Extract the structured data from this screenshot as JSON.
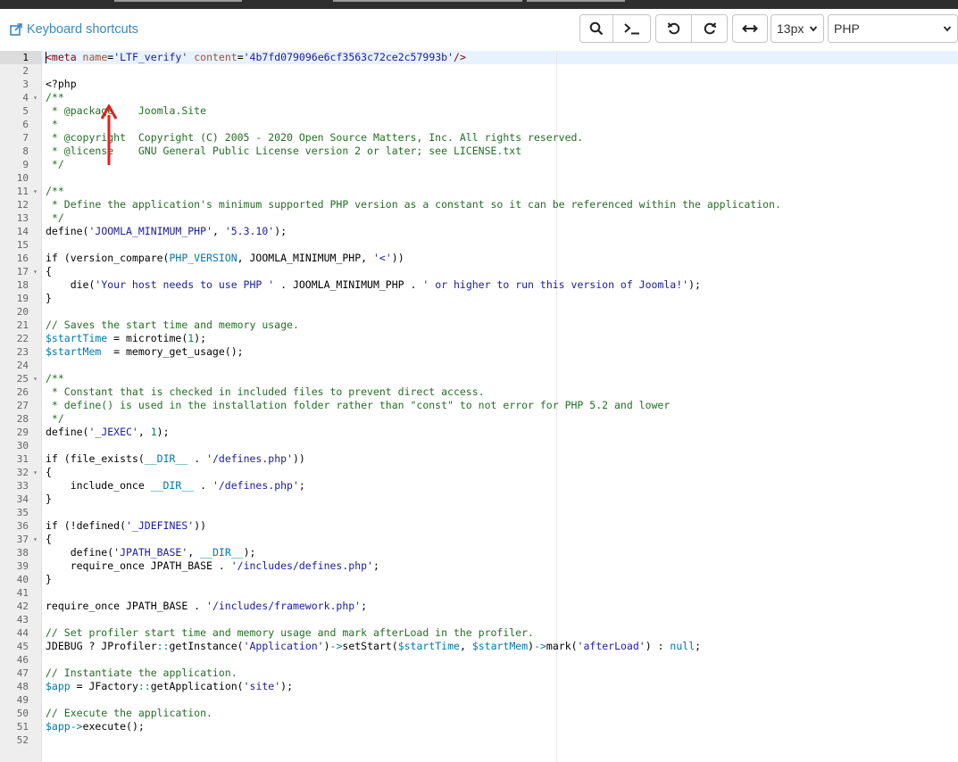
{
  "toolbar": {
    "shortcuts_label": "Keyboard shortcuts",
    "font_size": "13px",
    "language": "PHP",
    "icons": [
      "search-icon",
      "terminal-icon",
      "undo-icon",
      "redo-icon",
      "wrap-icon"
    ]
  },
  "colors": {
    "tag": "#800000",
    "attribute": "#a0522d",
    "string": "#1a1aa6",
    "comment": "#236e24",
    "variable": "#0077aa",
    "arrow": "#e02020"
  },
  "editor": {
    "active_line": 1,
    "fold_lines": [
      4,
      11,
      17,
      25,
      32,
      37
    ],
    "lines": [
      [
        [
          "tag",
          "<meta "
        ],
        [
          "attr",
          "name"
        ],
        [
          "def",
          "="
        ],
        [
          "str",
          "'LTF_verify'"
        ],
        [
          "def",
          " "
        ],
        [
          "attr",
          "content"
        ],
        [
          "def",
          "="
        ],
        [
          "str",
          "'4b7fd079096e6cf3563c72ce2c57993b'"
        ],
        [
          "tag",
          "/>"
        ]
      ],
      [],
      [
        [
          "def",
          "<?php"
        ]
      ],
      [
        [
          "com",
          "/**"
        ]
      ],
      [
        [
          "com",
          " * @package    Joomla.Site"
        ]
      ],
      [
        [
          "com",
          " *"
        ]
      ],
      [
        [
          "com",
          " * @copyright  Copyright (C) 2005 - 2020 Open Source Matters, Inc. All rights reserved."
        ]
      ],
      [
        [
          "com",
          " * @license    GNU General Public License version 2 or later; see LICENSE.txt"
        ]
      ],
      [
        [
          "com",
          " */"
        ]
      ],
      [],
      [
        [
          "com",
          "/**"
        ]
      ],
      [
        [
          "com",
          " * Define the application's minimum supported PHP version as a constant so it can be referenced within the application."
        ]
      ],
      [
        [
          "com",
          " */"
        ]
      ],
      [
        [
          "def",
          "define("
        ],
        [
          "str",
          "'JOOMLA_MINIMUM_PHP'"
        ],
        [
          "def",
          ", "
        ],
        [
          "str",
          "'5.3.10'"
        ],
        [
          "def",
          ");"
        ]
      ],
      [],
      [
        [
          "kw",
          "if"
        ],
        [
          "def",
          " (version_compare("
        ],
        [
          "var",
          "PHP_VERSION"
        ],
        [
          "def",
          ", JOOMLA_MINIMUM_PHP, "
        ],
        [
          "str",
          "'<'"
        ],
        [
          "def",
          "))"
        ]
      ],
      [
        [
          "def",
          "{"
        ]
      ],
      [
        [
          "def",
          "    die("
        ],
        [
          "str",
          "'Your host needs to use PHP '"
        ],
        [
          "def",
          " . JOOMLA_MINIMUM_PHP . "
        ],
        [
          "str",
          "' or higher to run this version of Joomla!'"
        ],
        [
          "def",
          ");"
        ]
      ],
      [
        [
          "def",
          "}"
        ]
      ],
      [],
      [
        [
          "com",
          "// Saves the start time and memory usage."
        ]
      ],
      [
        [
          "var",
          "$startTime"
        ],
        [
          "def",
          " = microtime("
        ],
        [
          "num",
          "1"
        ],
        [
          "def",
          ");"
        ]
      ],
      [
        [
          "var",
          "$startMem"
        ],
        [
          "def",
          "  = memory_get_usage();"
        ]
      ],
      [],
      [
        [
          "com",
          "/**"
        ]
      ],
      [
        [
          "com",
          " * Constant that is checked in included files to prevent direct access."
        ]
      ],
      [
        [
          "com",
          " * define() is used in the installation folder rather than \"const\" to not error for PHP 5.2 and lower"
        ]
      ],
      [
        [
          "com",
          " */"
        ]
      ],
      [
        [
          "def",
          "define("
        ],
        [
          "str",
          "'_JEXEC'"
        ],
        [
          "def",
          ", "
        ],
        [
          "num",
          "1"
        ],
        [
          "def",
          ");"
        ]
      ],
      [],
      [
        [
          "kw",
          "if"
        ],
        [
          "def",
          " (file_exists("
        ],
        [
          "var",
          "__DIR__"
        ],
        [
          "def",
          " . "
        ],
        [
          "str",
          "'/defines.php'"
        ],
        [
          "def",
          "))"
        ]
      ],
      [
        [
          "def",
          "{"
        ]
      ],
      [
        [
          "def",
          "    include_once "
        ],
        [
          "var",
          "__DIR__"
        ],
        [
          "def",
          " . "
        ],
        [
          "str",
          "'/defines.php'"
        ],
        [
          "def",
          ";"
        ]
      ],
      [
        [
          "def",
          "}"
        ]
      ],
      [],
      [
        [
          "kw",
          "if"
        ],
        [
          "def",
          " (!defined("
        ],
        [
          "str",
          "'_JDEFINES'"
        ],
        [
          "def",
          "))"
        ]
      ],
      [
        [
          "def",
          "{"
        ]
      ],
      [
        [
          "def",
          "    define("
        ],
        [
          "str",
          "'JPATH_BASE'"
        ],
        [
          "def",
          ", "
        ],
        [
          "var",
          "__DIR__"
        ],
        [
          "def",
          ");"
        ]
      ],
      [
        [
          "def",
          "    require_once JPATH_BASE . "
        ],
        [
          "str",
          "'/includes/defines.php'"
        ],
        [
          "def",
          ";"
        ]
      ],
      [
        [
          "def",
          "}"
        ]
      ],
      [],
      [
        [
          "def",
          "require_once JPATH_BASE . "
        ],
        [
          "str",
          "'/includes/framework.php'"
        ],
        [
          "def",
          ";"
        ]
      ],
      [],
      [
        [
          "com",
          "// Set profiler start time and memory usage and mark afterLoad in the profiler."
        ]
      ],
      [
        [
          "def",
          "JDEBUG ? JProfiler"
        ],
        [
          "var",
          "::"
        ],
        [
          "def",
          "getInstance("
        ],
        [
          "str",
          "'Application'"
        ],
        [
          "def",
          ")"
        ],
        [
          "var",
          "->"
        ],
        [
          "def",
          "setStart("
        ],
        [
          "var",
          "$startTime"
        ],
        [
          "def",
          ", "
        ],
        [
          "var",
          "$startMem"
        ],
        [
          "def",
          ")"
        ],
        [
          "var",
          "->"
        ],
        [
          "def",
          "mark("
        ],
        [
          "str",
          "'afterLoad'"
        ],
        [
          "def",
          ") : "
        ],
        [
          "var",
          "null"
        ],
        [
          "def",
          ";"
        ]
      ],
      [],
      [
        [
          "com",
          "// Instantiate the application."
        ]
      ],
      [
        [
          "var",
          "$app"
        ],
        [
          "def",
          " = JFactory"
        ],
        [
          "var",
          "::"
        ],
        [
          "def",
          "getApplication("
        ],
        [
          "str",
          "'site'"
        ],
        [
          "def",
          ");"
        ]
      ],
      [],
      [
        [
          "com",
          "// Execute the application."
        ]
      ],
      [
        [
          "var",
          "$app"
        ],
        [
          "var",
          "->"
        ],
        [
          "def",
          "execute();"
        ]
      ],
      []
    ]
  }
}
